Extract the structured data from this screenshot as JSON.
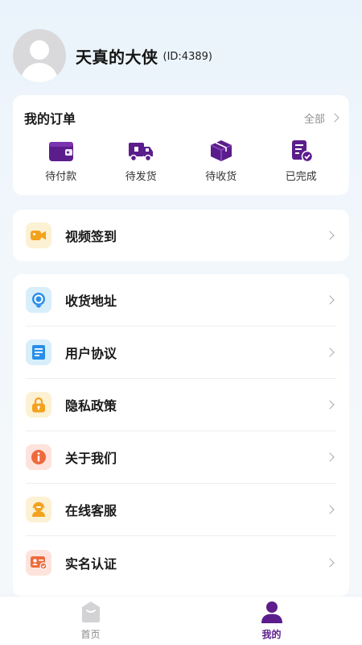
{
  "profile": {
    "name": "天真的大侠",
    "id_text": "(ID:4389)"
  },
  "orders": {
    "title": "我的订单",
    "all_label": "全部",
    "items": [
      {
        "label": "待付款",
        "icon": "wallet-icon"
      },
      {
        "label": "待发货",
        "icon": "truck-icon"
      },
      {
        "label": "待收货",
        "icon": "package-icon"
      },
      {
        "label": "已完成",
        "icon": "completed-doc-icon"
      }
    ]
  },
  "video": {
    "label": "视频签到",
    "icon": "video-camera-icon"
  },
  "menu": {
    "items": [
      {
        "label": "收货地址",
        "icon": "location-pin-icon"
      },
      {
        "label": "用户协议",
        "icon": "document-icon"
      },
      {
        "label": "隐私政策",
        "icon": "lock-icon"
      },
      {
        "label": "关于我们",
        "icon": "info-icon"
      },
      {
        "label": "在线客服",
        "icon": "customer-service-icon"
      },
      {
        "label": "实名认证",
        "icon": "id-card-icon"
      }
    ]
  },
  "tabbar": {
    "home_label": "首页",
    "mine_label": "我的"
  },
  "colors": {
    "accent": "#5b1d8c",
    "background": "#eaf3fb"
  }
}
